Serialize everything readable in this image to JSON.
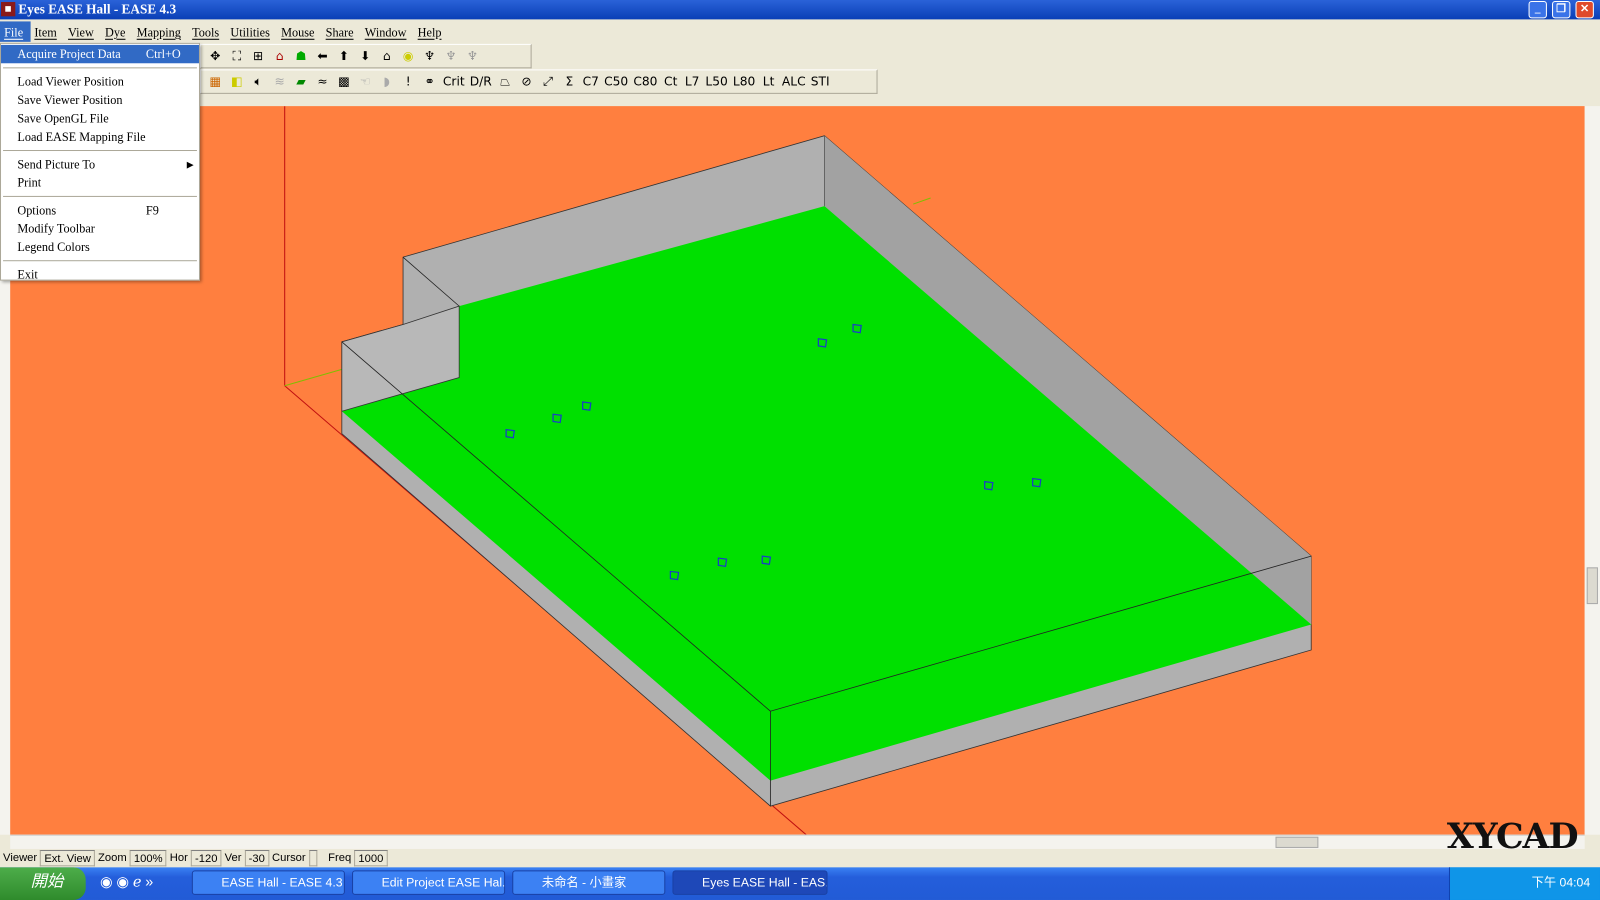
{
  "window": {
    "title": "Eyes EASE Hall - EASE 4.3",
    "logo": "EASE"
  },
  "menubar": [
    "File",
    "Item",
    "View",
    "Dye",
    "Mapping",
    "Tools",
    "Utilities",
    "Mouse",
    "Share",
    "Window",
    "Help"
  ],
  "file_menu": {
    "items": [
      {
        "label": "Acquire Project Data",
        "shortcut": "Ctrl+O",
        "highlighted": true
      },
      {
        "label": "Load Viewer Position"
      },
      {
        "label": "Save Viewer Position"
      },
      {
        "label": "Save OpenGL File"
      },
      {
        "label": "Load EASE Mapping File"
      },
      {
        "label": "Send Picture To",
        "submenu": true
      },
      {
        "label": "Print"
      },
      {
        "label": "Options",
        "shortcut": "F9"
      },
      {
        "label": "Modify Toolbar"
      },
      {
        "label": "Legend Colors"
      },
      {
        "label": "Exit"
      }
    ]
  },
  "toolbar2_labels": [
    "!",
    "Crit",
    "D/R",
    "Σ",
    "C7",
    "C50",
    "C80",
    "Ct",
    "L7",
    "L50",
    "L80",
    "Lt",
    "ALC",
    "STI"
  ],
  "statusbar": {
    "viewer_label": "Viewer",
    "viewer": "Ext. View",
    "zoom_label": "Zoom",
    "zoom": "100%",
    "hor_label": "Hor",
    "hor": "-120",
    "ver_label": "Ver",
    "ver": "-30",
    "cursor_label": "Cursor",
    "cursor": "",
    "freq_label": "Freq",
    "freq": "1000"
  },
  "taskbar": {
    "start": "開始",
    "tasks": [
      "EASE Hall - EASE 4.3",
      "Edit Project EASE Hal...",
      "未命名 - 小畫家",
      "Eyes EASE Hall - EAS..."
    ],
    "clock": "下午 04:04"
  },
  "watermark": "XYCAD",
  "colors": {
    "background": "#ff7f3f",
    "floor": "#00e000",
    "walls": "#b4b4b4",
    "speaker": "#1a3cc8"
  }
}
